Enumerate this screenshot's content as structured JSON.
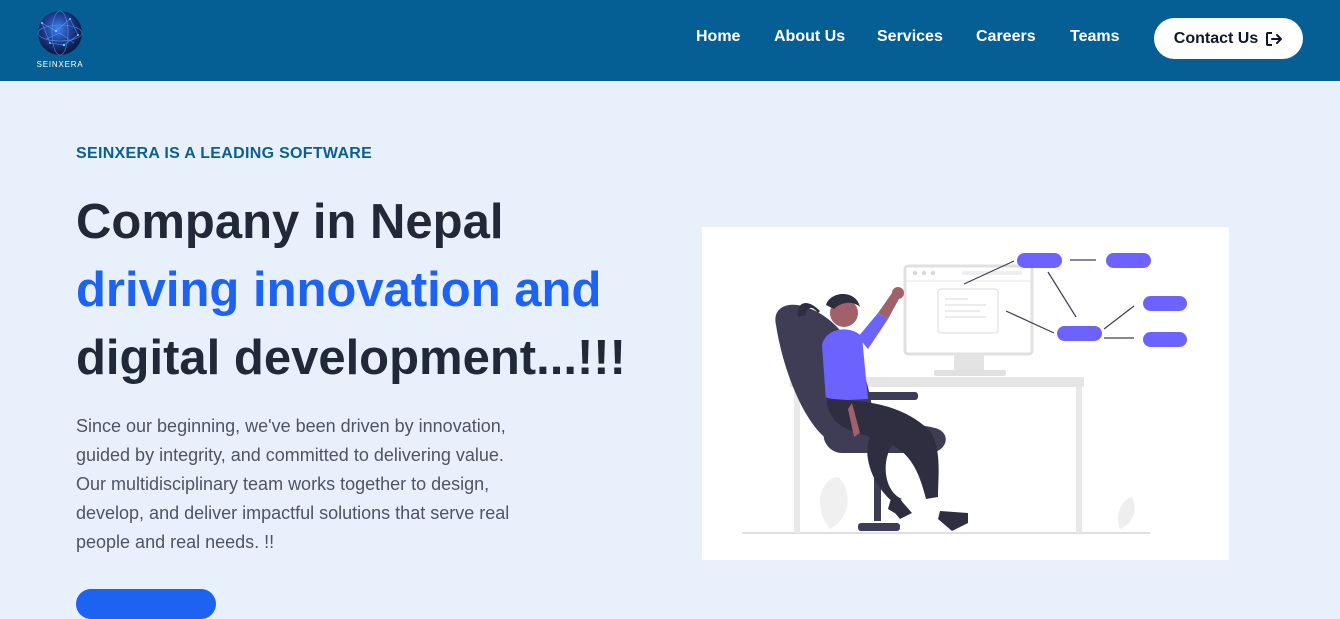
{
  "brand": {
    "name": "SEINXERA"
  },
  "nav": {
    "links": [
      {
        "label": "Home"
      },
      {
        "label": "About Us"
      },
      {
        "label": "Services"
      },
      {
        "label": "Careers"
      },
      {
        "label": "Teams"
      }
    ],
    "contact_label": "Contact Us",
    "contact_icon": "sign-in-icon"
  },
  "hero": {
    "eyebrow": "SEINXERA IS A LEADING SOFTWARE",
    "line1": "Company in Nepal",
    "line2": "driving innovation and",
    "line3": "digital development...!!!",
    "description": "Since our beginning, we've been driven by innovation, guided by integrity, and committed to delivering value. Our multidisciplinary team works together to design, develop, and deliver impactful solutions that serve real people and real needs. !!"
  },
  "colors": {
    "nav_bg": "#055f94",
    "page_bg": "#e8f1fb",
    "accent_blue": "#1d62f0",
    "eyebrow": "#0b5f8f",
    "heading_dark": "#1f2937",
    "illustration_purple": "#6c63ff"
  }
}
